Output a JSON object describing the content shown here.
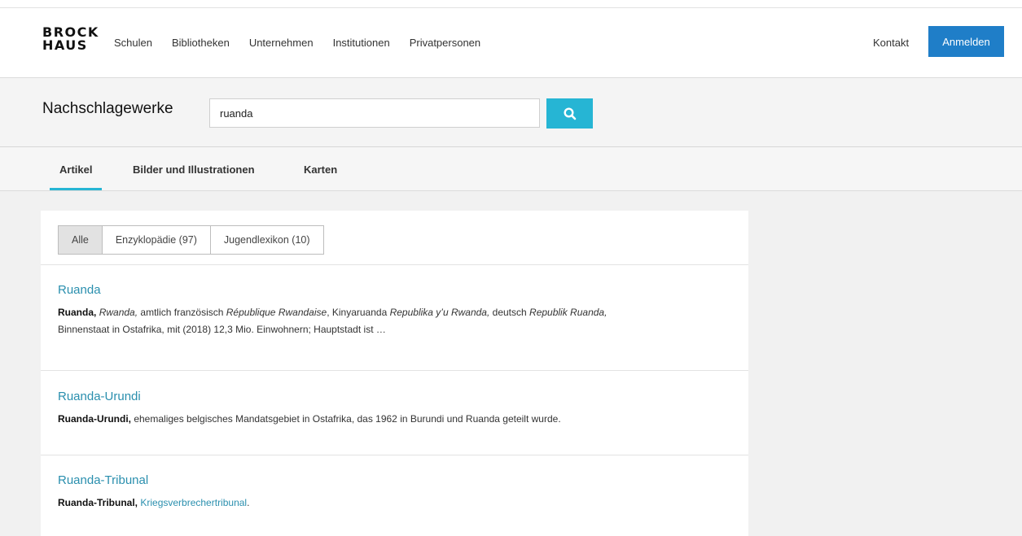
{
  "brand": {
    "line1": "BROCK",
    "line2": "HAUS"
  },
  "nav": {
    "items": [
      "Schulen",
      "Bibliotheken",
      "Unternehmen",
      "Institutionen",
      "Privatpersonen"
    ],
    "contact": "Kontakt",
    "login": "Anmelden"
  },
  "search": {
    "heading": "Nachschlagewerke",
    "value": "ruanda",
    "button_icon": "search-icon"
  },
  "tabs": [
    "Artikel",
    "Bilder und Illustrationen",
    "Karten"
  ],
  "active_tab": "Artikel",
  "filters": [
    "Alle",
    "Enzyklopädie (97)",
    "Jugendlexikon (10)"
  ],
  "active_filter": "Alle",
  "colors": {
    "accent": "#26b5d4",
    "primary_button": "#1f7ec8",
    "link": "#2a8fae"
  },
  "results": [
    {
      "title": "Ruanda",
      "bold": "Ruanda,",
      "t1": " ",
      "i1": "Rwanda,",
      "t2": " amtlich französisch ",
      "i2": "République Rwandaise",
      "t3": ", Kinyaruanda ",
      "i3": "Republika y’u Rwanda,",
      "t4": " deutsch ",
      "i4": "Republik Ruanda,",
      "t5": "Binnenstaat in Ostafrika, mit (2018) 12,3 Mio. Einwohnern; Hauptstadt ist …"
    },
    {
      "title": "Ruanda-Urundi",
      "bold": "Ruanda-Urundi,",
      "text": " ehemaliges belgisches Mandatsgebiet in Ostafrika, das 1962 in Burundi und Ruanda geteilt wurde."
    },
    {
      "title": "Ruanda-Tribunal",
      "bold": "Ruanda-Tribunal,",
      "link": "Kriegsverbrechertribunal",
      "after": "."
    }
  ]
}
